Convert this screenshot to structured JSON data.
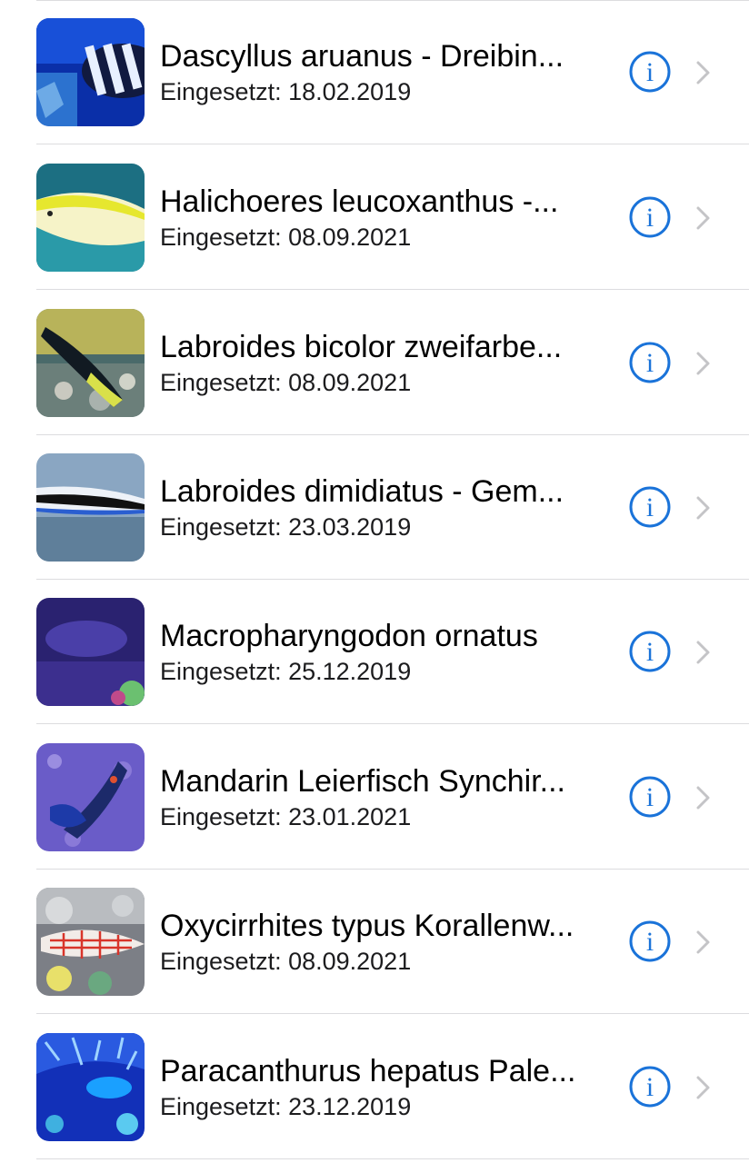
{
  "accent_color": "#1a73d9",
  "chevron_color": "#c4c4c7",
  "fish_list": [
    {
      "name": "Dascyllus aruanus - Dreibin...",
      "date": "Eingesetzt: 18.02.2019",
      "thumb_icon": "fish-photo-dascyllus"
    },
    {
      "name": "Halichoeres leucoxanthus -...",
      "date": "Eingesetzt: 08.09.2021",
      "thumb_icon": "fish-photo-halichoeres"
    },
    {
      "name": "Labroides bicolor zweifarbe...",
      "date": "Eingesetzt: 08.09.2021",
      "thumb_icon": "fish-photo-labroides-bicolor"
    },
    {
      "name": "Labroides dimidiatus - Gem...",
      "date": "Eingesetzt: 23.03.2019",
      "thumb_icon": "fish-photo-labroides-dimidiatus"
    },
    {
      "name": "Macropharyngodon ornatus",
      "date": "Eingesetzt: 25.12.2019",
      "thumb_icon": "fish-photo-macropharyngodon"
    },
    {
      "name": "Mandarin Leierfisch Synchir...",
      "date": "Eingesetzt: 23.01.2021",
      "thumb_icon": "fish-photo-mandarin"
    },
    {
      "name": "Oxycirrhites typus Korallenw...",
      "date": "Eingesetzt: 08.09.2021",
      "thumb_icon": "fish-photo-oxycirrhites"
    },
    {
      "name": "Paracanthurus hepatus Pale...",
      "date": "Eingesetzt: 23.12.2019",
      "thumb_icon": "fish-photo-paracanthurus"
    }
  ]
}
